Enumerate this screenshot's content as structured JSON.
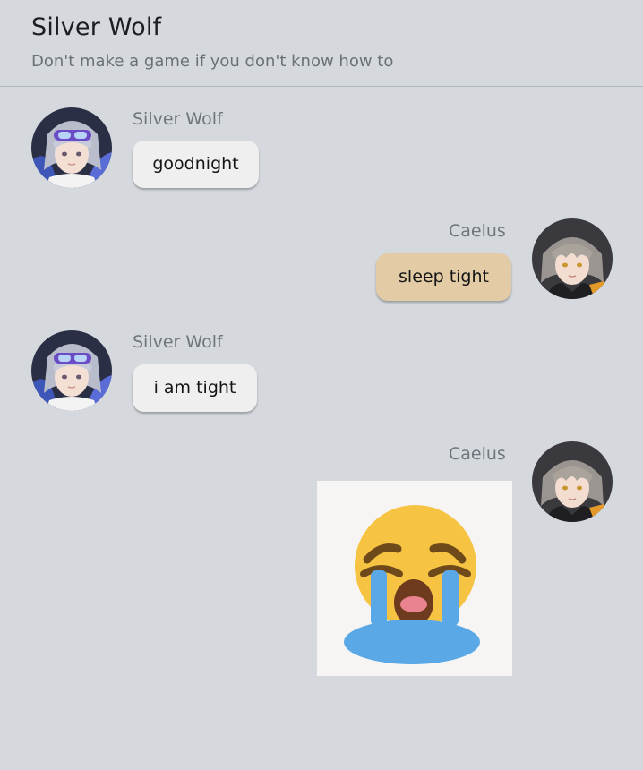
{
  "header": {
    "title": "Silver Wolf",
    "subtitle": "Don't make a game if you don't know how to"
  },
  "messages": [
    {
      "sender": "Silver Wolf",
      "text": "goodnight",
      "side": "incoming",
      "avatar": "silver-wolf-avatar"
    },
    {
      "sender": "Caelus",
      "text": "sleep tight",
      "side": "outgoing",
      "avatar": "caelus-avatar"
    },
    {
      "sender": "Silver Wolf",
      "text": "i am tight",
      "side": "incoming",
      "avatar": "silver-wolf-avatar"
    },
    {
      "sender": "Caelus",
      "sticker": "loudly-crying-face-emoji",
      "side": "outgoing",
      "avatar": "caelus-avatar"
    }
  ],
  "colors": {
    "background": "#d5d9de",
    "incoming_bubble": "#efefef",
    "outgoing_bubble": "#e2cba5",
    "emoji_face": "#f6c343",
    "emoji_tears": "#5aa9e6"
  }
}
